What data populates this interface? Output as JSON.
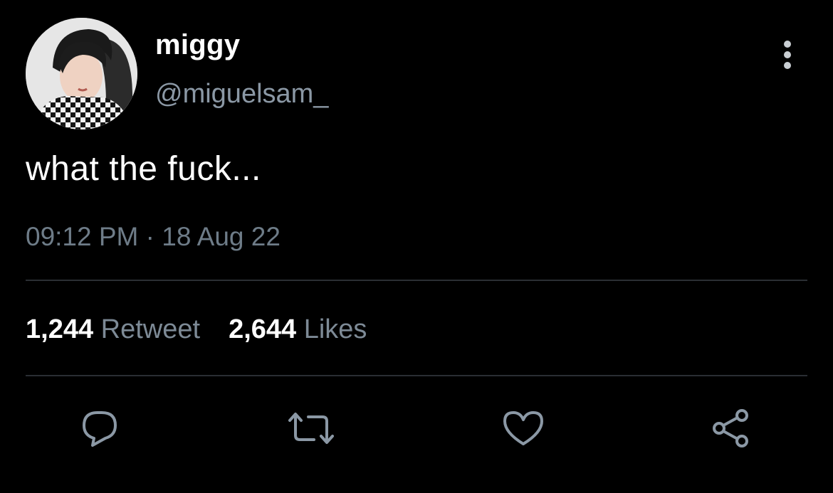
{
  "user": {
    "name": "miggy",
    "handle": "@miguelsam_"
  },
  "tweet": {
    "text": "what the fuck...",
    "time": "09:12 PM",
    "separator": " · ",
    "date": "18 Aug 22"
  },
  "stats": {
    "retweets_count": "1,244",
    "retweets_label": "Retweet",
    "likes_count": "2,644",
    "likes_label": "Likes"
  },
  "actions": [
    {
      "icon": "reply-icon"
    },
    {
      "icon": "retweet-icon"
    },
    {
      "icon": "like-icon"
    },
    {
      "icon": "share-icon"
    }
  ],
  "colors": {
    "background": "#000000",
    "primary_text": "#ffffff",
    "secondary_text": "#8b98a5",
    "divider": "#2a2e33",
    "icon": "#8b98a5"
  }
}
